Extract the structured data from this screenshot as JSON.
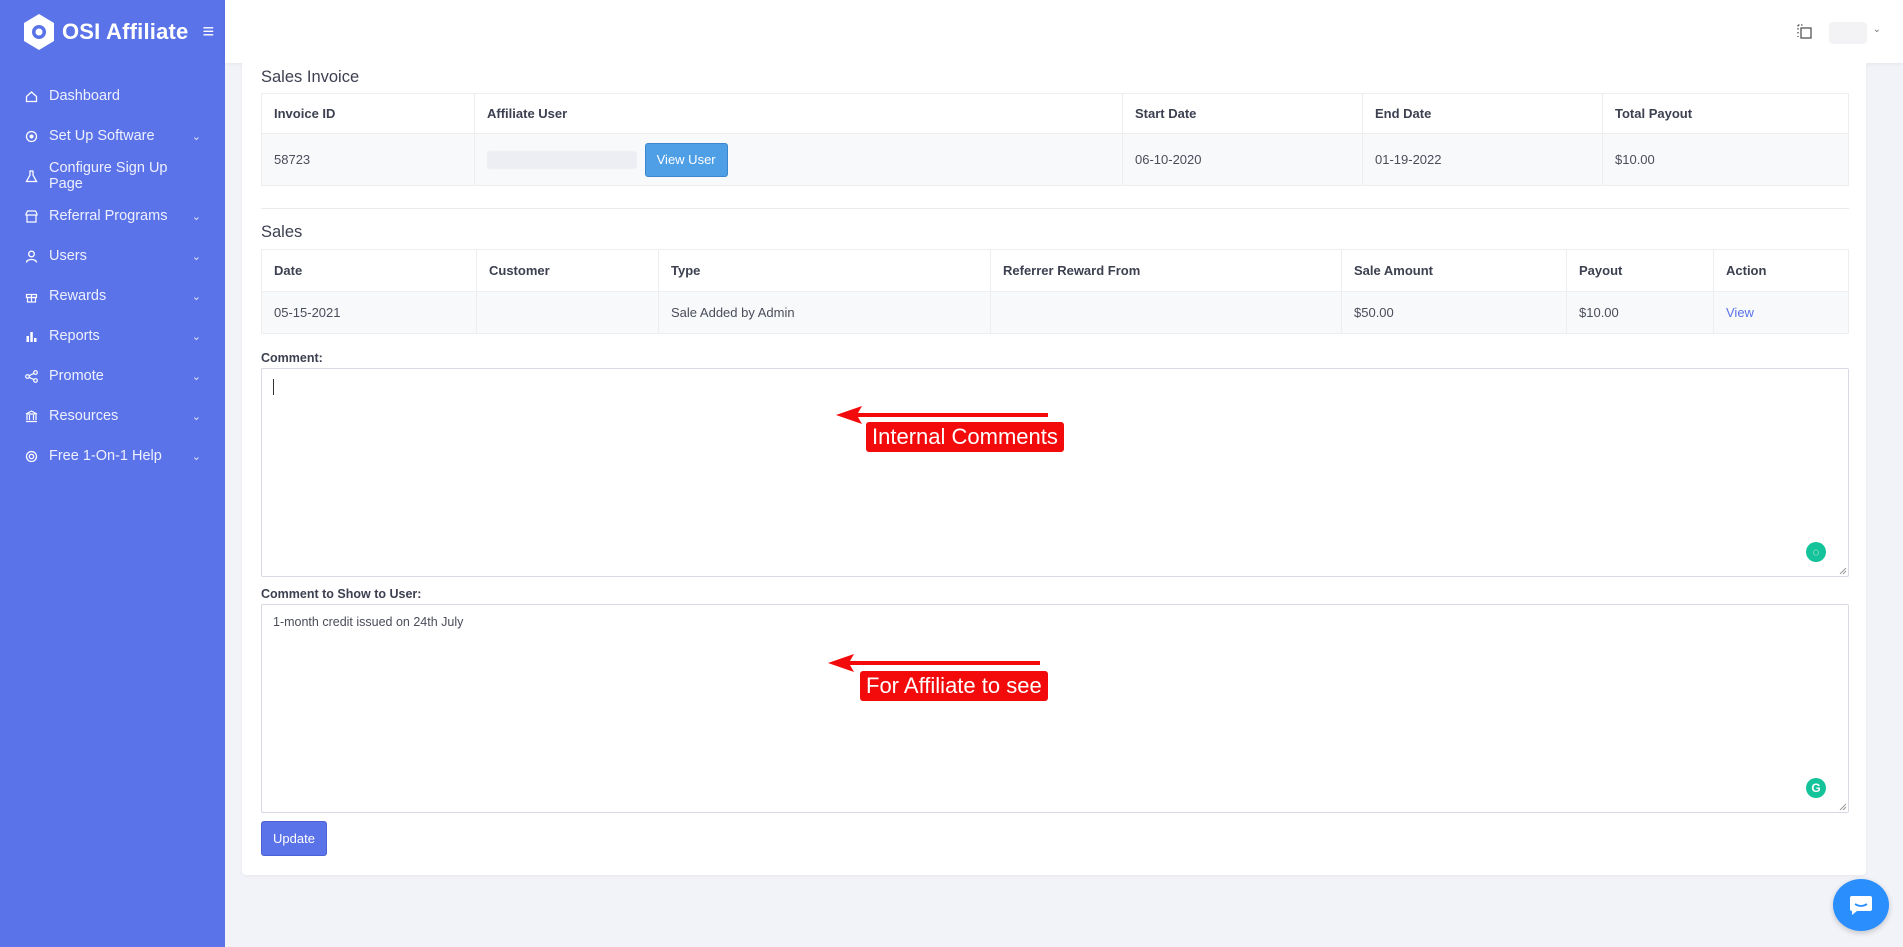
{
  "brand": {
    "name": "OSI Affiliate"
  },
  "sidebar": {
    "items": [
      {
        "label": "Dashboard",
        "icon": "home-icon",
        "expandable": false
      },
      {
        "label": "Set Up Software",
        "icon": "settings-icon",
        "expandable": true
      },
      {
        "label": "Configure Sign Up Page",
        "icon": "flask-icon",
        "expandable": false
      },
      {
        "label": "Referral Programs",
        "icon": "store-icon",
        "expandable": true
      },
      {
        "label": "Users",
        "icon": "user-icon",
        "expandable": true
      },
      {
        "label": "Rewards",
        "icon": "gift-icon",
        "expandable": true
      },
      {
        "label": "Reports",
        "icon": "bar-chart-icon",
        "expandable": true
      },
      {
        "label": "Promote",
        "icon": "share-icon",
        "expandable": true
      },
      {
        "label": "Resources",
        "icon": "bank-icon",
        "expandable": true
      },
      {
        "label": "Free 1-On-1 Help",
        "icon": "life-ring-icon",
        "expandable": true
      }
    ]
  },
  "invoice": {
    "title": "Sales Invoice",
    "headers": [
      "Invoice ID",
      "Affiliate User",
      "Start Date",
      "End Date",
      "Total Payout"
    ],
    "row": {
      "invoice_id": "58723",
      "view_user_label": "View User",
      "start_date": "06-10-2020",
      "end_date": "01-19-2022",
      "total_payout": "$10.00"
    }
  },
  "sales": {
    "title": "Sales",
    "headers": [
      "Date",
      "Customer",
      "Type",
      "Referrer Reward From",
      "Sale Amount",
      "Payout",
      "Action"
    ],
    "rows": [
      {
        "date": "05-15-2021",
        "customer": "",
        "type": "Sale Added by Admin",
        "referrer_reward_from": "",
        "sale_amount": "$50.00",
        "payout": "$10.00",
        "action": "View"
      }
    ]
  },
  "comment": {
    "label": "Comment:",
    "value": ""
  },
  "user_comment": {
    "label": "Comment to Show to User:",
    "value": "1-month credit issued on 24th July"
  },
  "update_label": "Update",
  "annotations": {
    "internal": "Internal Comments",
    "affiliate": "For Affiliate to see"
  },
  "colors": {
    "sidebar": "#5b73e8",
    "accent": "#5b73e8",
    "view_user_button": "#4e9fe5",
    "annotation": "#f30b0b",
    "grammarly": "#15c39a",
    "chat": "#2a8ffd"
  }
}
